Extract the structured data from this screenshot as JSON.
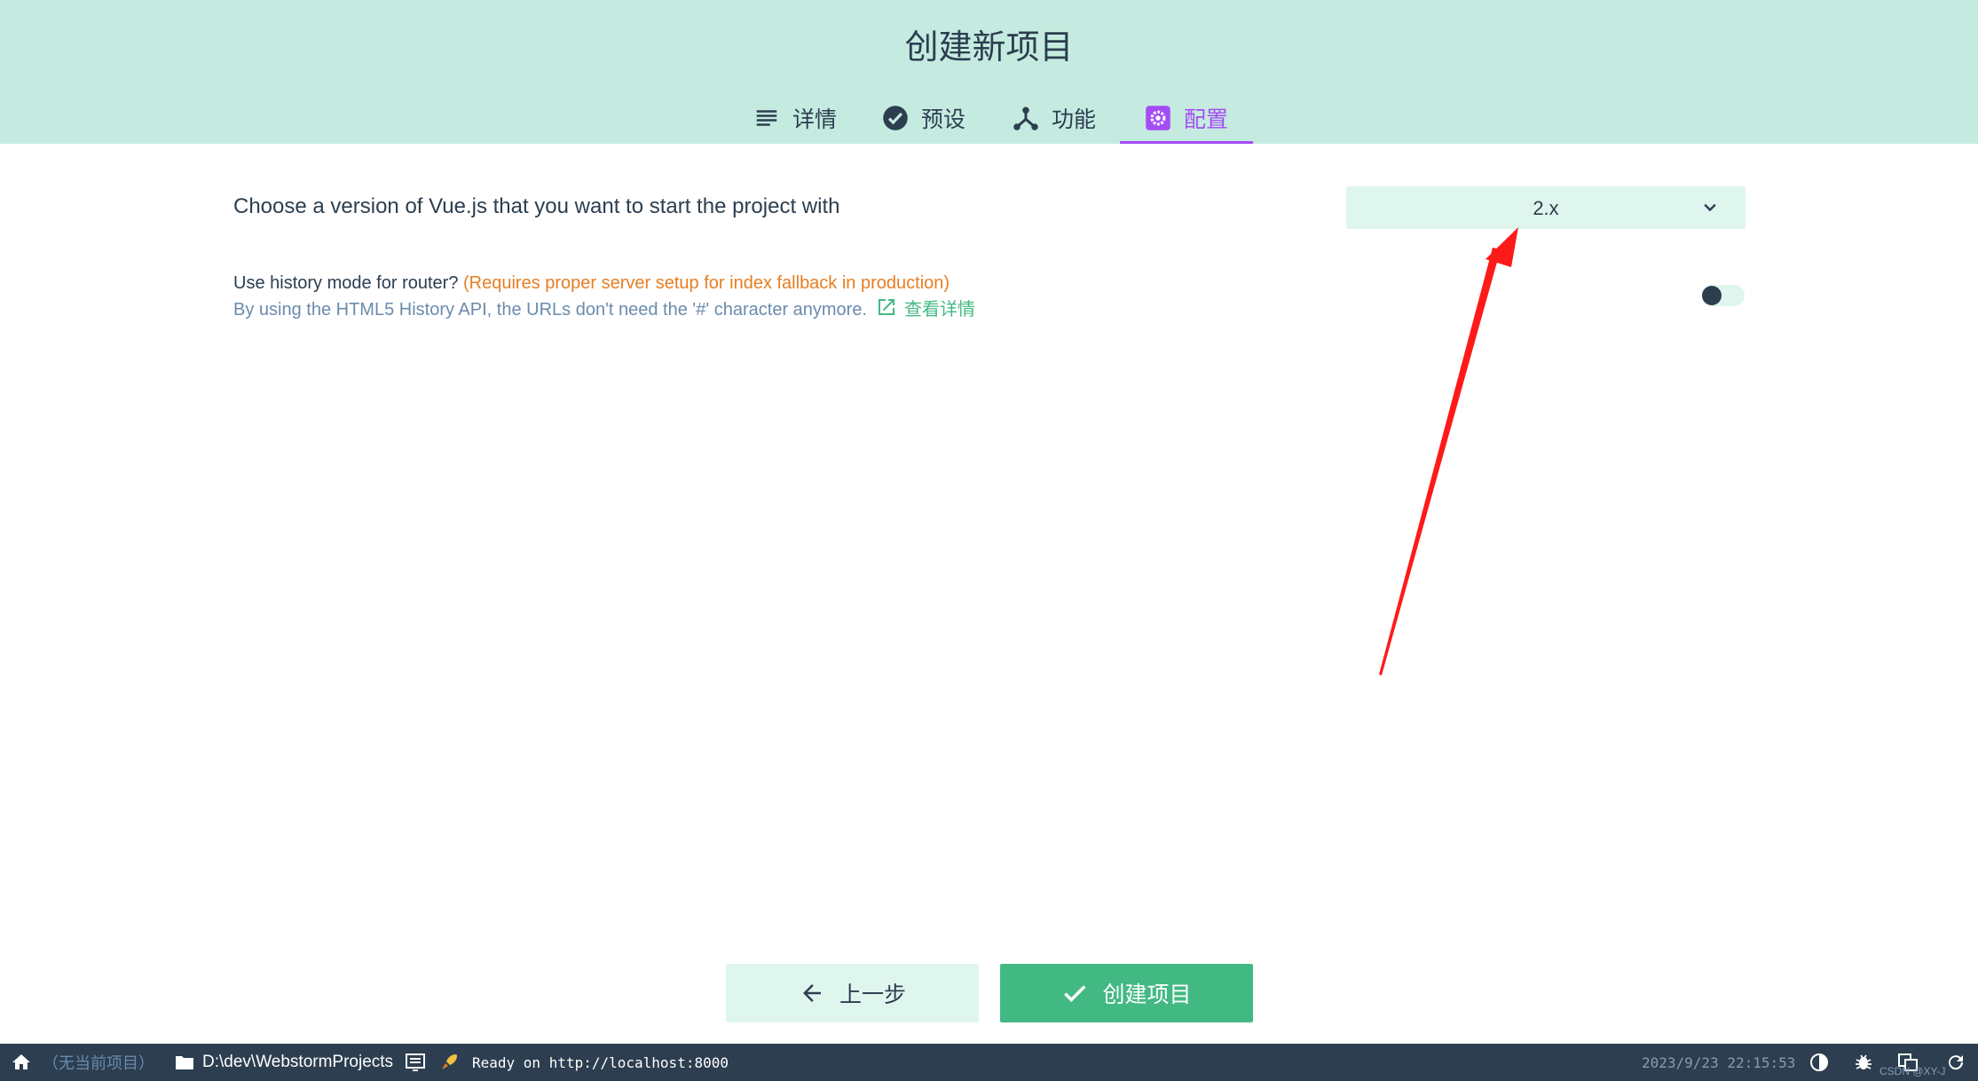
{
  "header": {
    "title": "创建新项目",
    "tabs": [
      {
        "label": "详情",
        "icon": "list-icon"
      },
      {
        "label": "预设",
        "icon": "check-circle-icon"
      },
      {
        "label": "功能",
        "icon": "fork-icon"
      },
      {
        "label": "配置",
        "icon": "gear-box-icon",
        "active": true
      }
    ]
  },
  "config": {
    "version_label": "Choose a version of Vue.js that you want to start the project with",
    "version_value": "2.x",
    "history_question": "Use history mode for router?",
    "history_warning": "(Requires proper server setup for index fallback in production)",
    "history_description": "By using the HTML5 History API, the URLs don't need the '#' character anymore.",
    "more_info_link": "查看详情",
    "history_enabled": false
  },
  "buttons": {
    "prev_label": "上一步",
    "create_label": "创建项目"
  },
  "statusbar": {
    "no_project": "（无当前项目）",
    "path": "D:\\dev\\WebstormProjects",
    "log": "Ready on http://localhost:8000",
    "datetime": "2023/9/23 22:15:53",
    "watermark": "CSDN @XY-J"
  },
  "colors": {
    "accent": "#42b983",
    "active_tab": "#a44cf6",
    "header_bg": "#c5ebe0",
    "statusbar_bg": "#2c3e50",
    "warning": "#e67e22",
    "annotation_arrow": "#ff1a1a"
  }
}
